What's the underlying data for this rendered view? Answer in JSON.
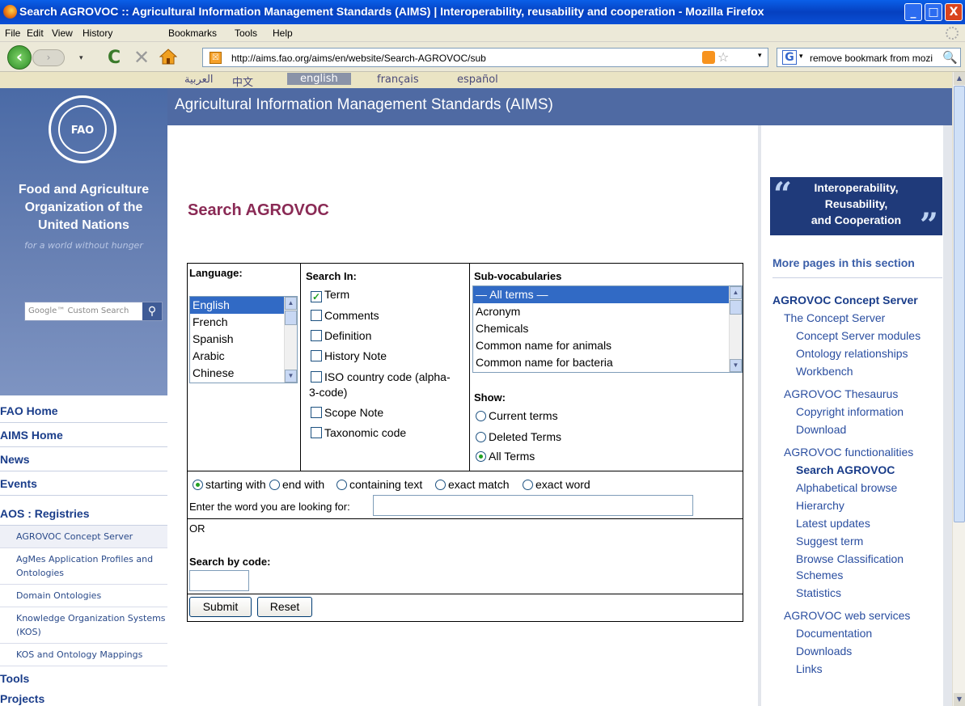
{
  "window": {
    "title": "Search AGROVOC :: Agricultural Information Management Standards (AIMS) | Interoperability, reusability and cooperation - Mozilla Firefox",
    "min": "_",
    "max": "□",
    "close": "X"
  },
  "menu": [
    "File",
    "Edit",
    "View",
    "History",
    "Bookmarks",
    "Tools",
    "Help"
  ],
  "nav": {
    "url": "http://aims.fao.org/aims/en/website/Search-AGROVOC/sub",
    "search_query": "remove bookmark from mozi",
    "back_glyph": "‹",
    "fwd_glyph": "›",
    "reload_glyph": "C",
    "stop_glyph": "✕",
    "dropdown_glyph": "▾",
    "star_glyph": "☆",
    "search_glyph": "🔍",
    "google_glyph": "G"
  },
  "languages": [
    "العربية",
    "中文",
    "english",
    "français",
    "español"
  ],
  "sidebar": {
    "org_name": "Food and Agriculture Organization of the United Nations",
    "org_line1": "Food and Agriculture",
    "org_line2": "Organization of the",
    "org_line3": "United Nations",
    "motto": "for a world without hunger",
    "search_placeholder": "Google™ Custom Search",
    "logo_text": "FAO",
    "main_links": [
      "FAO Home",
      "AIMS Home",
      "News",
      "Events"
    ],
    "section": "AOS : Registries",
    "sub_links": [
      "AGROVOC Concept Server",
      "AgMes Application Profiles and Ontologies",
      "Domain Ontologies",
      "Knowledge Organization Systems (KOS)",
      "KOS and Ontology Mappings"
    ],
    "bottom_links": [
      "Tools",
      "Projects"
    ]
  },
  "header": {
    "title": "Agricultural Information Management Standards (AIMS)"
  },
  "page": {
    "title": "Search AGROVOC"
  },
  "form": {
    "language_label": "Language:",
    "languages": [
      "English",
      "French",
      "Spanish",
      "Arabic",
      "Chinese"
    ],
    "selected_language": "English",
    "search_in_label": "Search In:",
    "search_in": [
      {
        "label": "Term",
        "checked": true
      },
      {
        "label": "Comments",
        "checked": false
      },
      {
        "label": "Definition",
        "checked": false
      },
      {
        "label": "History Note",
        "checked": false
      },
      {
        "label": "ISO country code (alpha-",
        "label2": "3-code)",
        "checked": false
      },
      {
        "label": "Scope Note",
        "checked": false
      },
      {
        "label": "Taxonomic code",
        "checked": false
      }
    ],
    "subvocab_label": "Sub-vocabularies",
    "subvocabs": [
      "— All terms —",
      "Acronym",
      "Chemicals",
      "Common name for animals",
      "Common name for bacteria"
    ],
    "show_label": "Show:",
    "show_options": [
      {
        "label": "Current terms",
        "checked": false
      },
      {
        "label": "Deleted Terms",
        "checked": false
      },
      {
        "label": "All Terms",
        "checked": true
      }
    ],
    "match_options": [
      {
        "label": "starting with",
        "checked": true
      },
      {
        "label": "end with",
        "checked": false
      },
      {
        "label": "containing text",
        "checked": false
      },
      {
        "label": "exact match",
        "checked": false
      },
      {
        "label": "exact word",
        "checked": false
      }
    ],
    "word_label": "Enter the word you are looking for:",
    "word_value": "",
    "or_label": "OR",
    "code_label": "Search by code:",
    "code_value": "",
    "submit": "Submit",
    "reset": "Reset"
  },
  "right": {
    "quote_line1": "Interoperability,",
    "quote_line2": "Reusability,",
    "quote_line3": "and Cooperation",
    "more_pages": "More pages in this section",
    "links": [
      {
        "text": "AGROVOC Concept Server",
        "level": 0,
        "style": "b"
      },
      {
        "text": "The Concept Server",
        "level": 1
      },
      {
        "text": "Concept Server modules",
        "level": 2
      },
      {
        "text": "Ontology relationships",
        "level": 2
      },
      {
        "text": "Workbench",
        "level": 2
      },
      {
        "text": "AGROVOC Thesaurus",
        "level": 1
      },
      {
        "text": "Copyright information",
        "level": 2
      },
      {
        "text": "Download",
        "level": 2
      },
      {
        "text": "AGROVOC functionalities",
        "level": 1
      },
      {
        "text": "Search AGROVOC",
        "level": 2,
        "style": "cur"
      },
      {
        "text": "Alphabetical browse",
        "level": 2
      },
      {
        "text": "Hierarchy",
        "level": 2
      },
      {
        "text": "Latest updates",
        "level": 2
      },
      {
        "text": "Suggest term",
        "level": 2
      },
      {
        "text": "Browse Classification",
        "level": 2
      },
      {
        "text": "Schemes",
        "level": 2
      },
      {
        "text": "Statistics",
        "level": 2
      },
      {
        "text": "AGROVOC web services",
        "level": 1
      },
      {
        "text": "Documentation",
        "level": 2
      },
      {
        "text": "Downloads",
        "level": 2
      },
      {
        "text": "Links",
        "level": 2
      }
    ]
  }
}
